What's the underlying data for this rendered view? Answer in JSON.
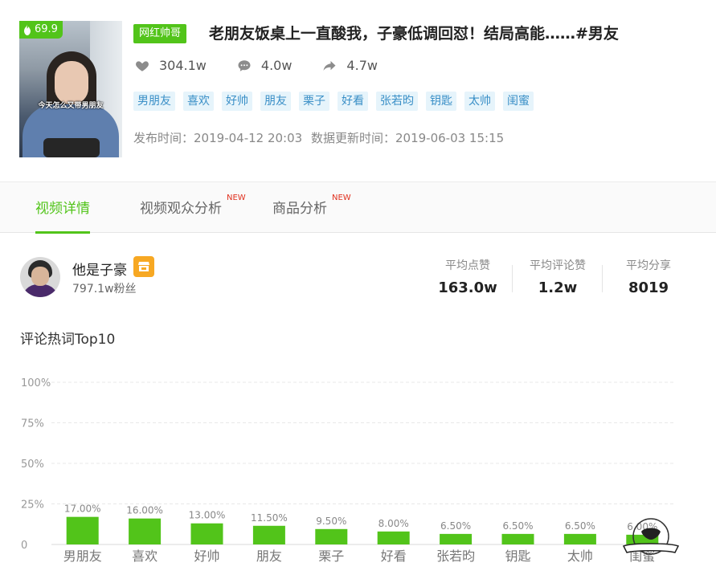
{
  "video": {
    "score": "69.9",
    "thumbnail_caption": "今天怎么又带男朋友",
    "category_badge": "网红帅哥",
    "title": "老朋友饭桌上一直酸我，子豪低调回怼！结局高能……#男友",
    "stats": [
      {
        "icon": "heart-icon",
        "value": "304.1w"
      },
      {
        "icon": "comment-icon",
        "value": "4.0w"
      },
      {
        "icon": "share-icon",
        "value": "4.7w"
      }
    ],
    "tags": [
      "男朋友",
      "喜欢",
      "好帅",
      "朋友",
      "栗子",
      "好看",
      "张若昀",
      "钥匙",
      "太帅",
      "闺蜜"
    ],
    "publish_label": "发布时间：",
    "publish_time": "2019-04-12 20:03",
    "update_label": "数据更新时间：",
    "update_time": "2019-06-03 15:15"
  },
  "tabs": [
    {
      "label": "视频详情",
      "active": true,
      "new": ""
    },
    {
      "label": "视频观众分析",
      "active": false,
      "new": "NEW"
    },
    {
      "label": "商品分析",
      "active": false,
      "new": "NEW"
    }
  ],
  "author": {
    "name": "他是子豪",
    "fans": "797.1w粉丝"
  },
  "metrics": [
    {
      "label": "平均点赞",
      "value": "163.0w"
    },
    {
      "label": "平均评论赞",
      "value": "1.2w"
    },
    {
      "label": "平均分享",
      "value": "8019"
    }
  ],
  "chart_section_title": "评论热词Top10",
  "colors": {
    "accent": "#52c41a",
    "tag_bg": "#e6f4fb",
    "tag_text": "#3a8fc7",
    "shop": "#f7a823",
    "new": "#e0301e"
  },
  "chart_data": {
    "type": "bar",
    "categories": [
      "男朋友",
      "喜欢",
      "好帅",
      "朋友",
      "栗子",
      "好看",
      "张若昀",
      "钥匙",
      "太帅",
      "闺蜜"
    ],
    "values": [
      17.0,
      16.0,
      13.0,
      11.5,
      9.5,
      8.0,
      6.5,
      6.5,
      6.5,
      6.0
    ],
    "data_labels": [
      "17.00%",
      "16.00%",
      "13.00%",
      "11.50%",
      "9.50%",
      "8.00%",
      "6.50%",
      "6.50%",
      "6.50%",
      "6.00%"
    ],
    "yticks": [
      "0",
      "25%",
      "50%",
      "75%",
      "100%"
    ],
    "ylim": [
      0,
      100
    ],
    "title": "",
    "xlabel": "",
    "ylabel": "",
    "grid": true,
    "color": "#52c41a"
  }
}
